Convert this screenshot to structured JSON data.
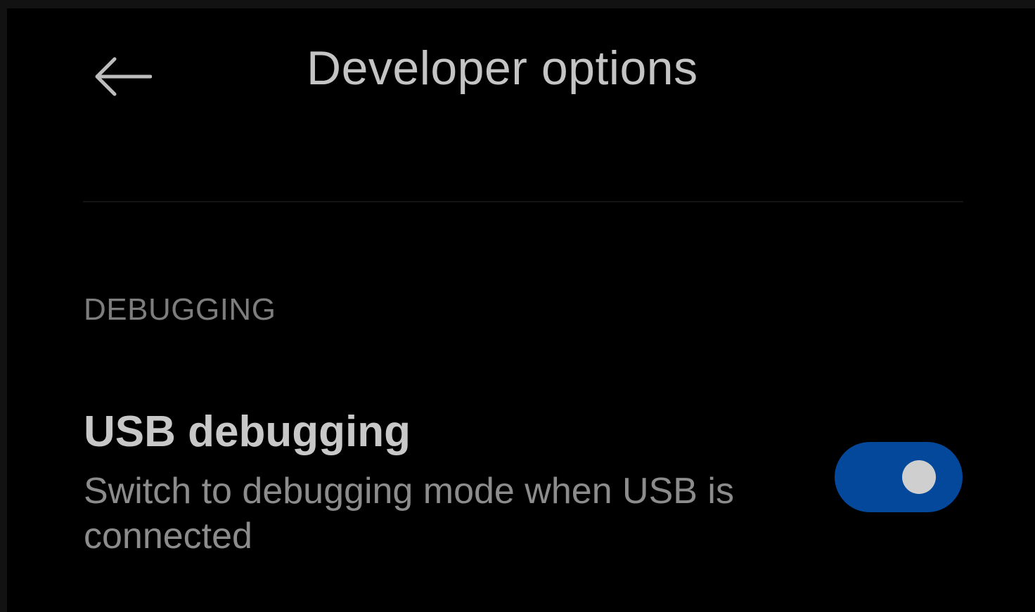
{
  "header": {
    "back_icon": "arrow-left-icon",
    "title": "Developer options"
  },
  "sections": [
    {
      "header": "DEBUGGING",
      "items": [
        {
          "title": "USB debugging",
          "summary": "Switch to debugging mode when USB is connected",
          "toggle_on": true
        }
      ]
    }
  ],
  "colors": {
    "background": "#000000",
    "toggle_track_on": "#04489b",
    "toggle_knob": "#cfcfcf",
    "title_text": "#c4c4c4",
    "section_header_text": "#7d7d7d",
    "summary_text": "#8c8c8c"
  }
}
